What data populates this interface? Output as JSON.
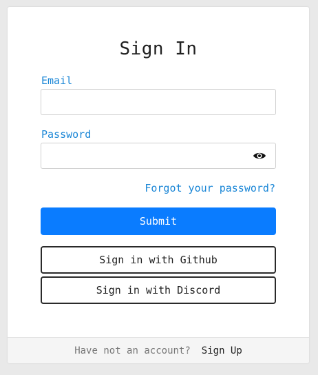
{
  "form": {
    "title": "Sign In",
    "email_label": "Email",
    "email_value": "",
    "password_label": "Password",
    "password_value": "",
    "forgot_link": "Forgot your password?",
    "submit_label": "Submit",
    "github_label": "Sign in with Github",
    "discord_label": "Sign in with Discord"
  },
  "footer": {
    "prompt": "Have not an account?",
    "signup_link": "Sign Up"
  },
  "icons": {
    "password_toggle": "eye-icon"
  },
  "colors": {
    "accent": "#0a7cff",
    "label": "#1a86d6",
    "button_border": "#2a2a2a"
  }
}
